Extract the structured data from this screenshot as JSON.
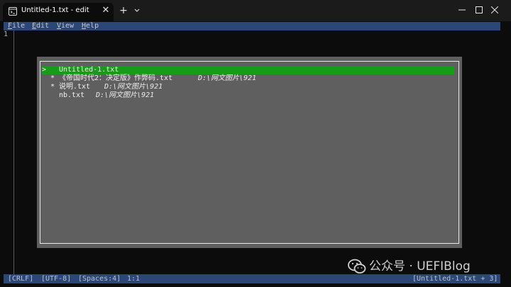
{
  "window": {
    "tab_title": "Untitled-1.txt - edit",
    "close_tab_glyph": "✕",
    "new_tab_glyph": "+"
  },
  "menubar": {
    "items": [
      {
        "accel": "F",
        "rest": "ile"
      },
      {
        "accel": "E",
        "rest": "dit"
      },
      {
        "accel": "V",
        "rest": "iew"
      },
      {
        "accel": "H",
        "rest": "elp"
      }
    ]
  },
  "editor": {
    "line_numbers": [
      "1"
    ]
  },
  "file_picker": {
    "files": [
      {
        "marker": ">",
        "name": "Untitled-1.txt",
        "path": "",
        "selected": true
      },
      {
        "marker": "*",
        "name": "《帝国时代2：决定版》作弊码.txt",
        "path": "D:\\网文图片\\921",
        "selected": false
      },
      {
        "marker": "*",
        "name": "说明.txt",
        "path": "D:\\网文图片\\921",
        "selected": false
      },
      {
        "marker": "",
        "name": "nb.txt",
        "path": "D:\\网文图片\\921",
        "selected": false
      }
    ]
  },
  "statusbar": {
    "line_ending": "[CRLF]",
    "encoding": "[UTF-8]",
    "indent": "[Spaces:4]",
    "cursor": "1:1",
    "document": "[Untitled-1.txt + 3]"
  },
  "watermark": {
    "text": "公众号 · UEFIBlog"
  },
  "colors": {
    "accent_bar": "#2a4778",
    "selection": "#169c16",
    "dialog_bg": "#5f5f5f"
  }
}
